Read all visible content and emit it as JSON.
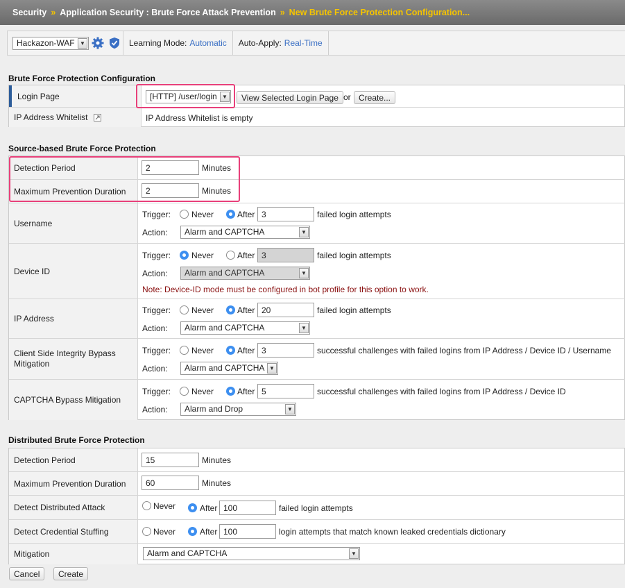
{
  "breadcrumb": {
    "items": [
      "Security",
      "Application Security : Brute Force Attack Prevention"
    ],
    "current": "New Brute Force Protection Configuration...",
    "separator": "»"
  },
  "policy_bar": {
    "policy": "Hackazon-WAF",
    "learning_mode_label": "Learning Mode:",
    "learning_mode_value": "Automatic",
    "auto_apply_label": "Auto-Apply:",
    "auto_apply_value": "Real-Time"
  },
  "bfp": {
    "title": "Brute Force Protection Configuration",
    "login_page_label": "Login Page",
    "login_page_value": "[HTTP] /user/login",
    "view_button": "View Selected Login Page",
    "or_text": "or",
    "create_button": "Create...",
    "whitelist_label": "IP Address Whitelist",
    "whitelist_value": "IP Address Whitelist is empty"
  },
  "source": {
    "title": "Source-based Brute Force Protection",
    "detection_period_label": "Detection Period",
    "detection_period_value": "2",
    "max_prevention_label": "Maximum Prevention Duration",
    "max_prevention_value": "2",
    "minutes": "Minutes",
    "trigger_label": "Trigger:",
    "action_label": "Action:",
    "never": "Never",
    "after": "After",
    "rows": [
      {
        "label": "Username",
        "trigger": "after",
        "count": "3",
        "suffix": "failed login attempts",
        "action": "Alarm and CAPTCHA",
        "disabled": false
      },
      {
        "label": "Device ID",
        "trigger": "never",
        "count": "3",
        "suffix": "failed login attempts",
        "action": "Alarm and CAPTCHA",
        "disabled": true,
        "note": "Note: Device-ID mode must be configured in bot profile for this option to work."
      },
      {
        "label": "IP Address",
        "trigger": "after",
        "count": "20",
        "suffix": "failed login attempts",
        "action": "Alarm and CAPTCHA",
        "disabled": false
      },
      {
        "label": "Client Side Integrity Bypass Mitigation",
        "trigger": "after",
        "count": "3",
        "suffix": "successful challenges with failed logins from IP Address / Device ID / Username",
        "action": "Alarm and CAPTCHA",
        "disabled": false
      },
      {
        "label": "CAPTCHA Bypass Mitigation",
        "trigger": "after",
        "count": "5",
        "suffix": "successful challenges with failed logins from IP Address / Device ID",
        "action": "Alarm and Drop",
        "disabled": false
      }
    ]
  },
  "distributed": {
    "title": "Distributed Brute Force Protection",
    "detection_period_label": "Detection Period",
    "detection_period_value": "15",
    "max_prevention_label": "Maximum Prevention Duration",
    "max_prevention_value": "60",
    "minutes": "Minutes",
    "detect_attack_label": "Detect Distributed Attack",
    "detect_attack_count": "100",
    "detect_attack_suffix": "failed login attempts",
    "credential_label": "Detect Credential Stuffing",
    "credential_count": "100",
    "credential_suffix": "login attempts that match known leaked credentials dictionary",
    "never": "Never",
    "after": "After",
    "mitigation_label": "Mitigation",
    "mitigation_value": "Alarm and CAPTCHA"
  },
  "footer": {
    "cancel": "Cancel",
    "create": "Create"
  },
  "colors": {
    "highlight": "#e8407a",
    "link": "#3a6fc4",
    "radio_selected": "#3d8ff0",
    "breadcrumb_current": "#f5c400"
  }
}
